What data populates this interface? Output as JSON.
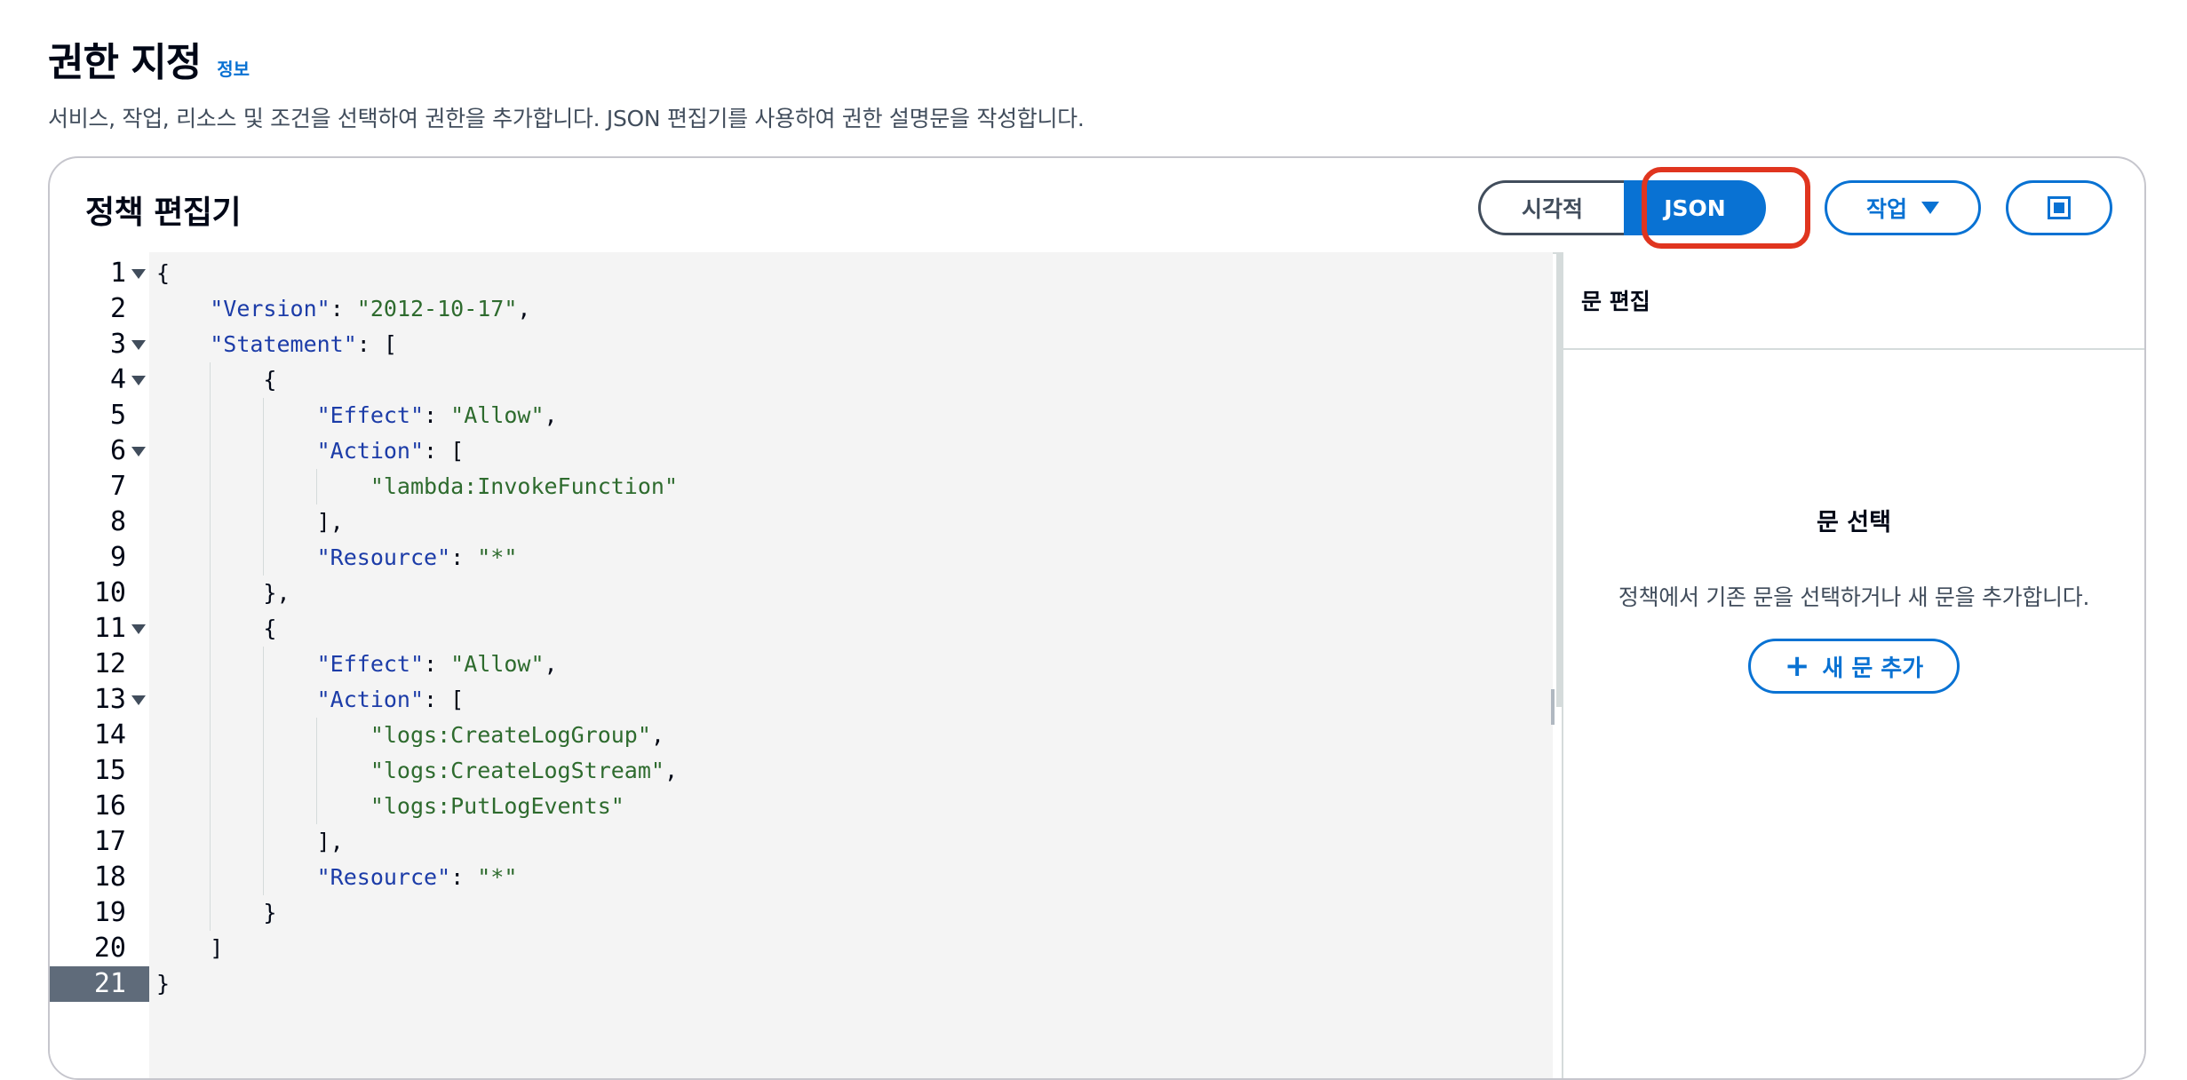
{
  "page": {
    "title": "권한 지정",
    "info_link": "정보",
    "description": "서비스, 작업, 리소스 및 조건을 선택하여 권한을 추가합니다. JSON 편집기를 사용하여 권한 설명문을 작성합니다."
  },
  "editor": {
    "title": "정책 편집기",
    "mode_visual": "시각적",
    "mode_json": "JSON",
    "selected_mode": "JSON",
    "actions_label": "작업",
    "fullscreen_icon": "fullscreen-icon"
  },
  "code_lines": [
    "{",
    "    \"Version\": \"2012-10-17\",",
    "    \"Statement\": [",
    "        {",
    "            \"Effect\": \"Allow\",",
    "            \"Action\": [",
    "                \"lambda:InvokeFunction\"",
    "            ],",
    "            \"Resource\": \"*\"",
    "        },",
    "        {",
    "            \"Effect\": \"Allow\",",
    "            \"Action\": [",
    "                \"logs:CreateLogGroup\",",
    "                \"logs:CreateLogStream\",",
    "                \"logs:PutLogEvents\"",
    "            ],",
    "            \"Resource\": \"*\"",
    "        }",
    "    ]",
    "}"
  ],
  "line_numbers": [
    "1",
    "2",
    "3",
    "4",
    "5",
    "6",
    "7",
    "8",
    "9",
    "10",
    "11",
    "12",
    "13",
    "14",
    "15",
    "16",
    "17",
    "18",
    "19",
    "20",
    "21"
  ],
  "foldable_lines": [
    1,
    3,
    4,
    6,
    11,
    13
  ],
  "active_line": 21,
  "side_panel": {
    "header": "문 편집",
    "empty_title": "문 선택",
    "empty_description": "정책에서 기존 문을 선택하거나 새 문을 추가합니다.",
    "add_button": "새 문 추가"
  },
  "colors": {
    "accent": "#0972d3",
    "highlight": "#e0351f",
    "json_key": "#1c3ca8",
    "json_string": "#2e6b2e"
  }
}
